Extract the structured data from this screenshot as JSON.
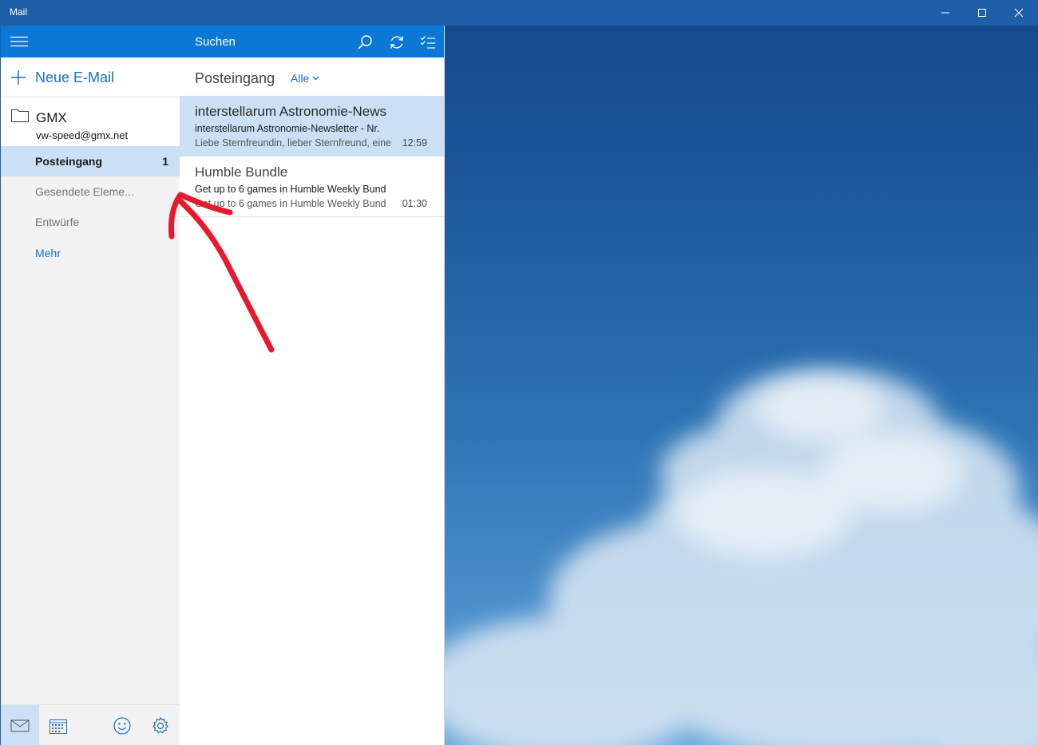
{
  "window": {
    "title": "Mail",
    "colors": {
      "titlebar": "#1e5fa9",
      "accent": "#0a78d4",
      "selected": "#cce0f5",
      "link": "#1a6fc4"
    }
  },
  "nav": {
    "new_mail_label": "Neue E-Mail",
    "account": {
      "name": "GMX",
      "email": "vw-speed@gmx.net"
    },
    "folders": [
      {
        "label": "Posteingang",
        "count": "1"
      },
      {
        "label": "Gesendete Eleme..."
      },
      {
        "label": "Entwürfe"
      },
      {
        "label": "Mehr"
      }
    ],
    "bottom_icons": [
      "mail-icon",
      "calendar-icon",
      "smiley-icon",
      "settings-gear-icon"
    ]
  },
  "list": {
    "search_label": "Suchen",
    "title": "Posteingang",
    "filter_label": "Alle",
    "messages": [
      {
        "sender": "interstellarum Astronomie-News",
        "subject": "interstellarum Astronomie-Newsletter - Nr.",
        "preview": "Liebe Sternfreundin, lieber Sternfreund, eine",
        "time": "12:59"
      },
      {
        "sender": "Humble Bundle",
        "subject": "Get up to 6 games in Humble Weekly Bund",
        "preview": "Get up to 6 games in Humble Weekly Bund",
        "time": "01:30"
      }
    ]
  }
}
